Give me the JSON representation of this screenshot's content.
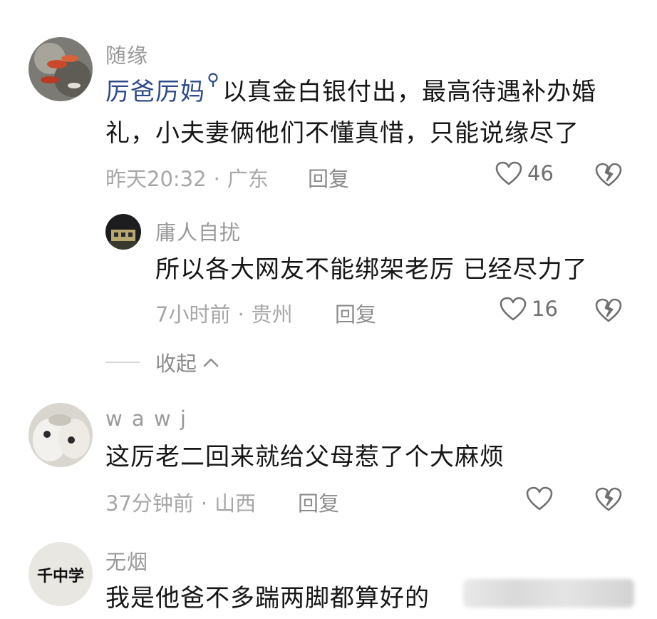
{
  "comments": [
    {
      "username": "随缘",
      "mention": "厉爸厉妈",
      "line1": "以真金白银付出，最高待遇补办婚",
      "line2": "礼，小夫妻俩他们不懂真惜，只能说缘尽了",
      "time": "昨天20:32",
      "location": "广东",
      "reply_label": "回复",
      "likes": "46"
    },
    {
      "username": "庸人自扰",
      "text": "所以各大网友不能绑架老厉 已经尽力了",
      "time": "7小时前",
      "location": "贵州",
      "reply_label": "回复",
      "likes": "16"
    },
    {
      "username": "w a w j",
      "text": "这厉老二回来就给父母惹了个大麻烦",
      "time": "37分钟前",
      "location": "山西",
      "reply_label": "回复"
    },
    {
      "username": "无烟",
      "avatar_text": "千中学",
      "text": "我是他爸不多踹两脚都算好的"
    }
  ],
  "collapse_label": "收起",
  "separator": "·",
  "icons": {
    "like": "heart-outline-icon",
    "dislike": "broken-heart-icon",
    "mention": "search-mention-icon",
    "collapse": "chevron-up-icon"
  },
  "colors": {
    "mention": "#2d4a8a",
    "text": "#161616",
    "meta": "#a7a7a7"
  }
}
